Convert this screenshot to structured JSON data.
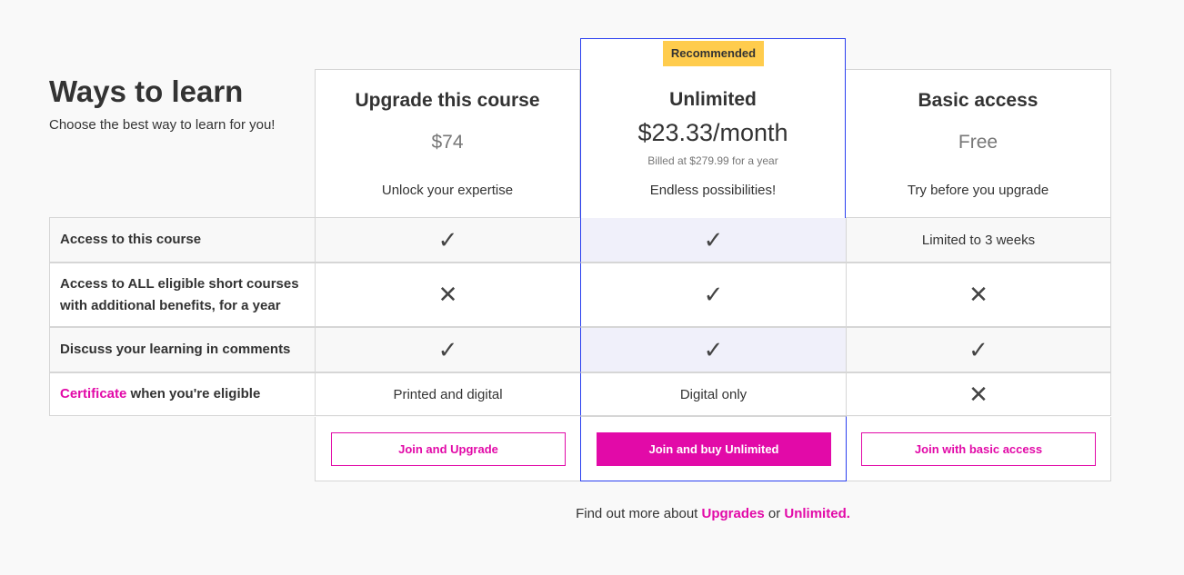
{
  "intro": {
    "title": "Ways to learn",
    "subtitle": "Choose the best way to learn for you!"
  },
  "plans": [
    {
      "name": "Upgrade this course",
      "price": "$74",
      "tagline": "Unlock your expertise",
      "button": "Join and Upgrade"
    },
    {
      "name": "Unlimited",
      "badge": "Recommended",
      "price": "$23.33/month",
      "billed": "Billed at $279.99 for a year",
      "tagline": "Endless possibilities!",
      "button": "Join and buy Unlimited"
    },
    {
      "name": "Basic access",
      "price": "Free",
      "tagline": "Try before you upgrade",
      "button": "Join with basic access"
    }
  ],
  "features": [
    {
      "label": "Access to this course",
      "values": [
        "check",
        "check",
        "Limited to 3 weeks"
      ]
    },
    {
      "label": "Access to ALL eligible short courses with additional benefits, for a year",
      "values": [
        "cross",
        "check",
        "cross"
      ]
    },
    {
      "label": "Discuss your learning in comments",
      "values": [
        "check",
        "check",
        "check"
      ]
    },
    {
      "label_link": "Certificate",
      "label": "when you're eligible",
      "values": [
        "Printed and digital",
        "Digital only",
        "cross"
      ]
    }
  ],
  "icons": {
    "check": "✓",
    "cross": "✕"
  },
  "footer": {
    "prefix": "Find out more about",
    "link1": "Upgrades",
    "mid": "or",
    "link2": "Unlimited."
  },
  "colors": {
    "accent": "#e20aa8",
    "recommended_border": "#2a3ff0",
    "badge": "#ffcc4d",
    "highlight": "#f0f0fa"
  }
}
